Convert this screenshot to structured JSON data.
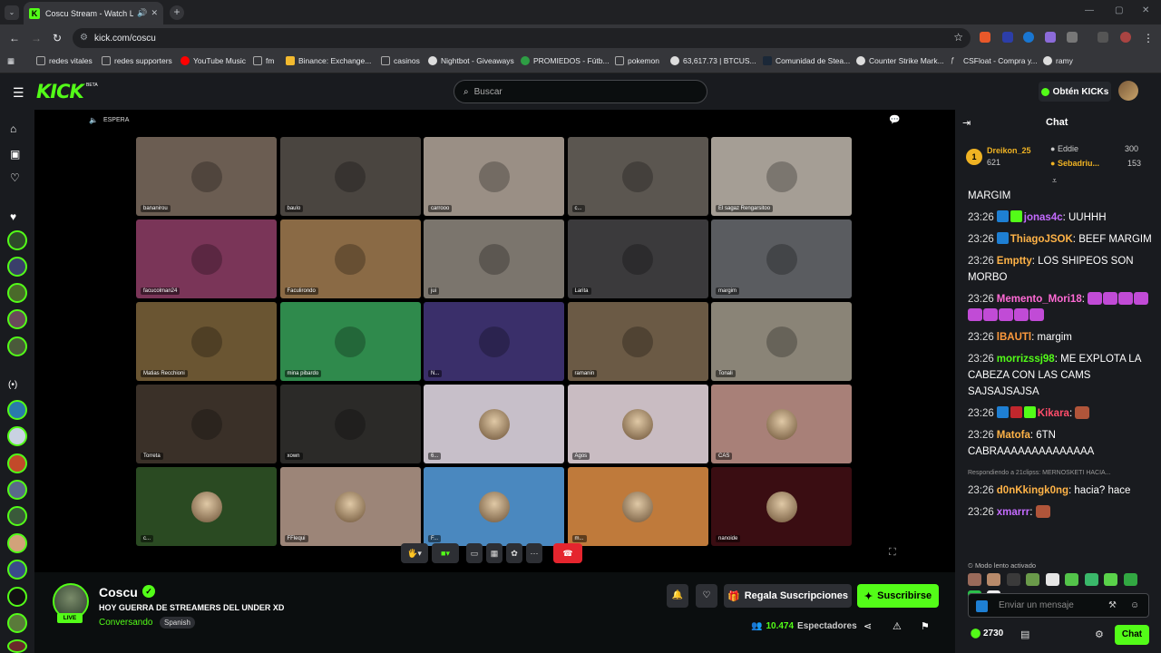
{
  "browser": {
    "tab_title": "Coscu Stream - Watch Live",
    "url": "kick.com/coscu",
    "bookmarks": [
      "redes vitales",
      "redes supporters",
      "YouTube Music",
      "fm",
      "Binance: Exchange...",
      "casinos",
      "Nightbot - Giveaways",
      "PROMIEDOS - Fútb...",
      "pokemon",
      "63,617.73 | BTCUS...",
      "Comunidad de Stea...",
      "Counter Strike Mark...",
      "CSFloat - Compra y...",
      "ramy"
    ]
  },
  "header": {
    "logo": "KICK",
    "beta": "BETA",
    "search_placeholder": "Buscar",
    "kicks_label": "Obtén KICKs"
  },
  "player": {
    "status": "ESPERA",
    "participants": [
      {
        "name": "bananirou",
        "color": "#6b5d52"
      },
      {
        "name": "baulo",
        "color": "#4a4540"
      },
      {
        "name": "carrooo",
        "color": "#9a8f85"
      },
      {
        "name": "c...",
        "color": "#5b5650"
      },
      {
        "name": "El sagaz Rengarsitoo",
        "color": "#a59e95"
      },
      {
        "name": "facucolman24",
        "color": "#7a3558"
      },
      {
        "name": "Faculirondo",
        "color": "#8a6a45"
      },
      {
        "name": "jui",
        "color": "#7b756d"
      },
      {
        "name": "Larita",
        "color": "#3b3a3c"
      },
      {
        "name": "margim",
        "color": "#5a5c60"
      },
      {
        "name": "Matias Recchioni",
        "color": "#6a5532"
      },
      {
        "name": "mina pibardo",
        "color": "#2f8a4c"
      },
      {
        "name": "N...",
        "color": "#3a2f6a"
      },
      {
        "name": "ramanin",
        "color": "#6b5a45"
      },
      {
        "name": "Tonali",
        "color": "#8a8477"
      },
      {
        "name": "Torreta",
        "color": "#3a3028"
      },
      {
        "name": "xown",
        "color": "#2b2a28"
      },
      {
        "name": "6...",
        "color": "#c7bfc9"
      },
      {
        "name": "Agos",
        "color": "#c9bcc2"
      },
      {
        "name": "CAS",
        "color": "#a88078"
      },
      {
        "name": "c...",
        "color": "#2a4a22"
      },
      {
        "name": "FFlequi",
        "color": "#9c8578"
      },
      {
        "name": "F...",
        "color": "#4a88bf"
      },
      {
        "name": "m...",
        "color": "#bf7a3b"
      },
      {
        "name": "nanoide",
        "color": "#3a0d12"
      }
    ]
  },
  "channel": {
    "name": "Coscu",
    "live_badge": "LIVE",
    "title": "HOY GUERRA DE STREAMERS DEL UNDER XD",
    "category": "Conversando",
    "language": "Spanish",
    "gift_label": "Regala Suscripciones",
    "subscribe_label": "Suscribirse",
    "viewers_count": "10.474",
    "viewers_label": "Espectadores"
  },
  "chat": {
    "title": "Chat",
    "top_gifters": [
      {
        "name": "Dreikon_25",
        "count": "621"
      },
      {
        "name": "Eddie",
        "count": "300"
      },
      {
        "name": "Sebadriu...",
        "count": "153"
      }
    ],
    "messages": [
      {
        "time": "",
        "user": "",
        "user_color": "#fff",
        "text": "MARGIM"
      },
      {
        "time": "23:26",
        "user": "jonas4c",
        "user_color": "#c46bff",
        "text": "UUHHH"
      },
      {
        "time": "23:26",
        "user": "ThiagoJSOK",
        "user_color": "#ffb347",
        "text": "BEEF MARGIM"
      },
      {
        "time": "23:26",
        "user": "Emptty",
        "user_color": "#ffb347",
        "text": "LOS SHIPEOS SON MORBO"
      },
      {
        "time": "23:26",
        "user": "Memento_Mori18",
        "user_color": "#ff6ad5",
        "text": ""
      },
      {
        "time": "23:26",
        "user": "lBAUTl",
        "user_color": "#ff9a3c",
        "text": "margim"
      },
      {
        "time": "23:26",
        "user": "morrizssj98",
        "user_color": "#53fc18",
        "text": "ME EXPLOTA LA CABEZA CON LAS CAMS SAJSAJSAJSA"
      },
      {
        "time": "23:26",
        "user": "Kikara",
        "user_color": "#ff4d6a",
        "text": ""
      },
      {
        "time": "23:26",
        "user": "Matofa",
        "user_color": "#ffb347",
        "text": "6TN CABRAAAAAAAAAAAAAA"
      },
      {
        "time": "23:26",
        "user": "d0nKkingk0ng",
        "user_color": "#ffb347",
        "text": "hacia? hace",
        "reply": "Respondiendo a 21clipss: MERNOSKETI HACIA..."
      },
      {
        "time": "23:26",
        "user": "xmarrr",
        "user_color": "#c46bff",
        "text": ""
      }
    ],
    "slow_mode": "Modo lento activado",
    "input_placeholder": "Enviar un mensaje",
    "points": "2730",
    "send_label": "Chat"
  }
}
